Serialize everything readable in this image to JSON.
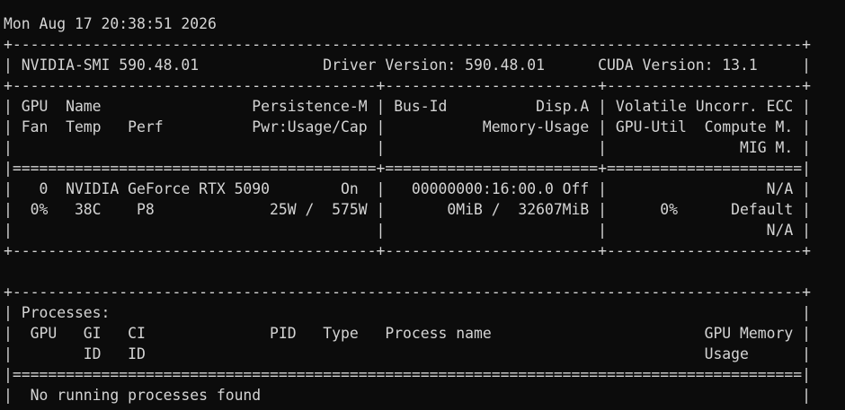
{
  "window": {
    "background": "#0c0c0c",
    "foreground": "#d4d4d4"
  },
  "terminal": {
    "lines": [
      "",
      "Mon Aug 17 20:38:51 2026",
      "+-----------------------------------------------------------------------------------------+",
      "| NVIDIA-SMI 590.48.01              Driver Version: 590.48.01      CUDA Version: 13.1     |",
      "+-----------------------------------------+------------------------+----------------------+",
      "| GPU  Name                 Persistence-M | Bus-Id          Disp.A | Volatile Uncorr. ECC |",
      "| Fan  Temp   Perf          Pwr:Usage/Cap |           Memory-Usage | GPU-Util  Compute M. |",
      "|                                         |                        |               MIG M. |",
      "|=========================================+========================+======================|",
      "|   0  NVIDIA GeForce RTX 5090        On  |   00000000:16:00.0 Off |                  N/A |",
      "|  0%   38C    P8             25W /  575W |       0MiB /  32607MiB |      0%      Default |",
      "|                                         |                        |                  N/A |",
      "+-----------------------------------------+------------------------+----------------------+",
      "",
      "+-----------------------------------------------------------------------------------------+",
      "| Processes:                                                                              |",
      "|  GPU   GI   CI              PID   Type   Process name                        GPU Memory |",
      "|        ID   ID                                                               Usage      |",
      "|=========================================================================================|",
      "|  No running processes found                                                             |",
      "+-----------------------------------------------------------------------------------------+"
    ]
  }
}
